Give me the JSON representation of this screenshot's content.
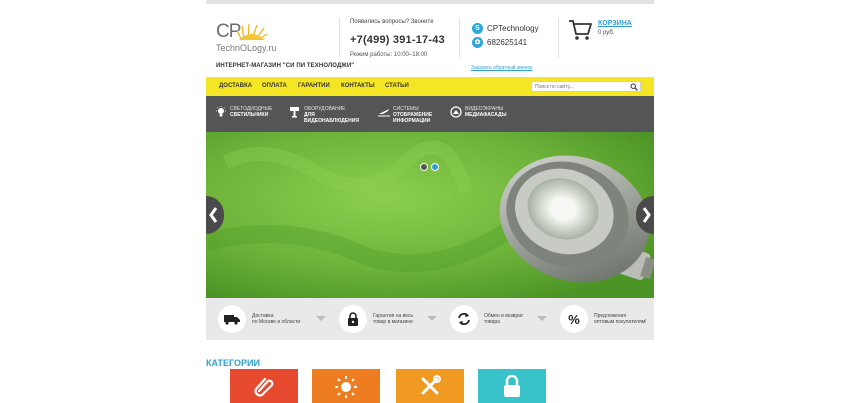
{
  "header": {
    "logo_cp": "CP",
    "logo_sub": "TechnOLogy.ru",
    "shop_name": "ИНТЕРНЕТ-МАГАЗИН \"СИ ПИ ТЕХНОЛОДЖИ\"",
    "question_text": "Появились вопросы? Звоните",
    "phone": "+7(499) 391-17-43",
    "hours": "Режим работы: 10:00–18:00",
    "skype": "CPTechnology",
    "icq": "682625141",
    "callback_link": "Заказать обратный звонок",
    "cart_title": "КОРЗИНА",
    "cart_sum": "0 руб."
  },
  "nav": {
    "items": [
      "ДОСТАВКА",
      "ОПЛАТА",
      "ГАРАНТИИ",
      "КОНТАКТЫ",
      "СТАТЬИ"
    ],
    "search_placeholder": "Поиск по сайту..."
  },
  "catbar": {
    "items": [
      {
        "line1": "СВЕТОДИОДНЫЕ",
        "line2": "СВЕТИЛЬНИКИ",
        "line3": "",
        "icon": "bulb-icon"
      },
      {
        "line1": "ОБОРУДОВАНИЕ",
        "line2": "ДЛЯ",
        "line3": "ВИДЕОНАБЛЮДЕНИЯ",
        "icon": "camera-icon"
      },
      {
        "line1": "СИСТЕМЫ",
        "line2": "ОТОБРАЖЕНИЕ",
        "line3": "ИНФОРМАЦИИ",
        "icon": "plane-icon"
      },
      {
        "line1": "ВИДЕОЭКРАНЫ",
        "line2": "МЕДИАФАСАДЫ",
        "line3": "",
        "icon": "screen-icon"
      }
    ]
  },
  "slider": {
    "active_slide": 2,
    "slides": 2
  },
  "features": [
    {
      "line1": "Доставка",
      "line2": "по Москве и области",
      "icon": "truck-icon"
    },
    {
      "line1": "Гарантия на весь",
      "line2": "товар в магазине",
      "icon": "lock-icon"
    },
    {
      "line1": "Обмен и возврат",
      "line2": "товара",
      "icon": "exchange-icon"
    },
    {
      "line1": "Предложения",
      "line2": "оптовым покупателям!",
      "icon": "percent-icon"
    }
  ],
  "categories": {
    "heading": "КАТЕГОРИИ",
    "tiles": [
      {
        "icon": "paperclip-icon",
        "color": "#e64a2f"
      },
      {
        "icon": "sun-icon",
        "color": "#ee7d22"
      },
      {
        "icon": "tools-icon",
        "color": "#f09a21"
      },
      {
        "icon": "lock-icon",
        "color": "#38c2c9"
      }
    ]
  },
  "colors": {
    "nav_yellow": "#f5e625",
    "catbar_dark": "#555558",
    "link_blue": "#2e9fd2",
    "slider_green": "#6db33a"
  }
}
